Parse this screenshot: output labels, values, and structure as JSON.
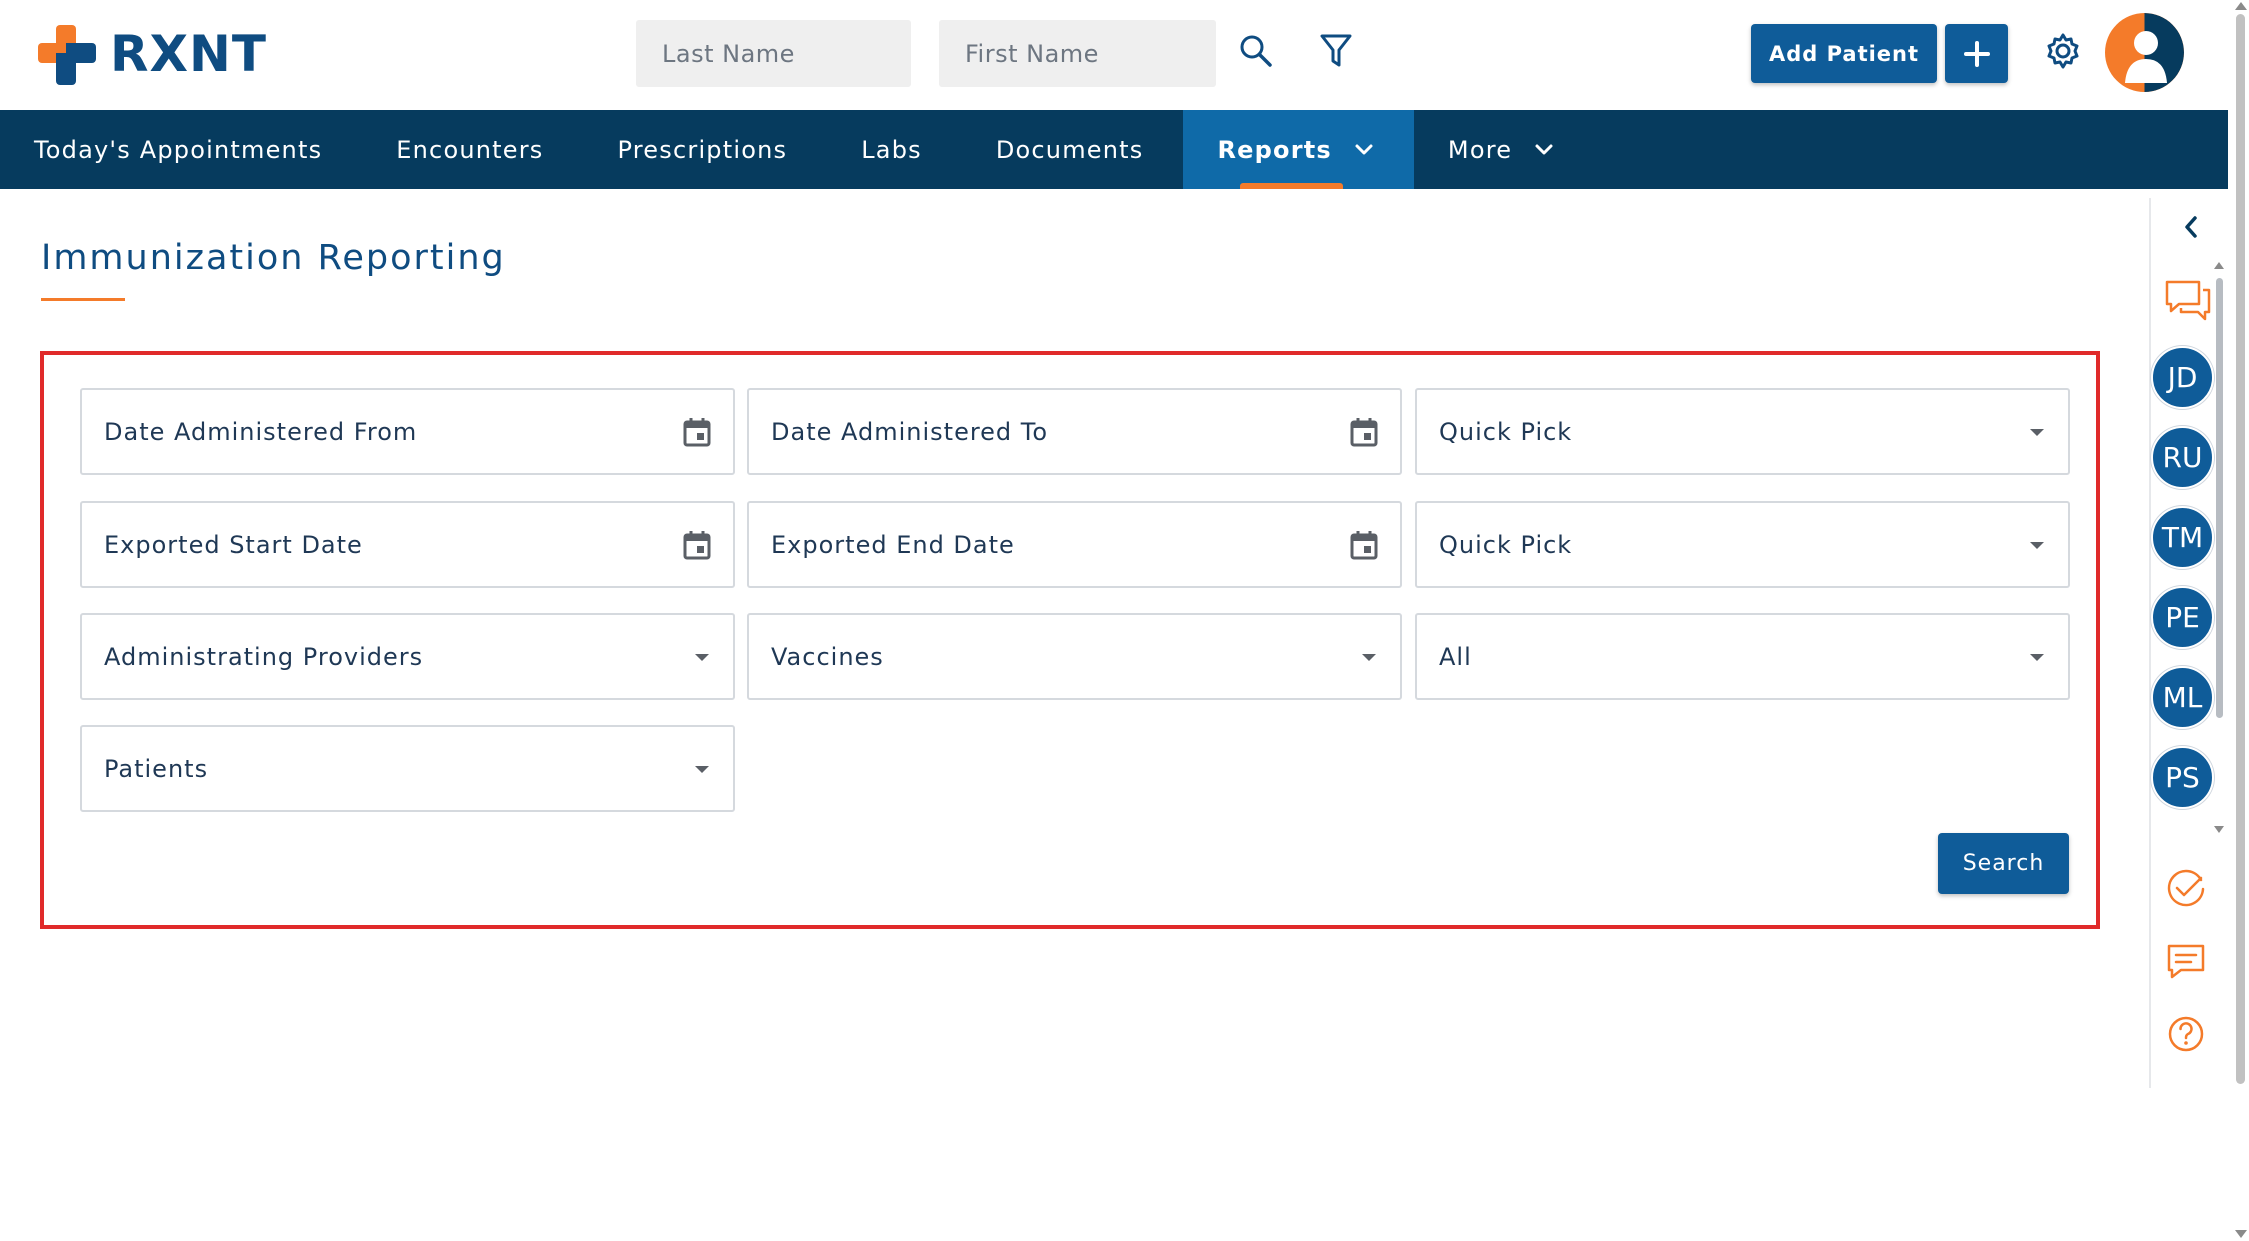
{
  "app": {
    "brand": "RXNT",
    "colors": {
      "primary": "#0f5c99",
      "nav": "#063b5e",
      "accent": "#f47b2a",
      "highlight_border": "#e02a2a"
    }
  },
  "header": {
    "last_name_placeholder": "Last Name",
    "first_name_placeholder": "First Name",
    "search_icon": "search-icon",
    "filter_icon": "filter-icon",
    "add_patient_label": "Add Patient",
    "plus_icon": "plus-icon",
    "settings_icon": "gear-icon",
    "user_icon": "user-avatar-icon"
  },
  "nav": {
    "items": [
      {
        "label": "Today's Appointments",
        "active": false
      },
      {
        "label": "Encounters",
        "active": false
      },
      {
        "label": "Prescriptions",
        "active": false
      },
      {
        "label": "Labs",
        "active": false
      },
      {
        "label": "Documents",
        "active": false
      },
      {
        "label": "Reports",
        "active": true,
        "dropdown": true
      },
      {
        "label": "More",
        "active": false,
        "dropdown": true
      }
    ]
  },
  "page": {
    "title": "Immunization Reporting"
  },
  "form": {
    "date_administered_from": "Date Administered From",
    "date_administered_to": "Date Administered To",
    "quick_pick_1": "Quick Pick",
    "exported_start_date": "Exported Start Date",
    "exported_end_date": "Exported End Date",
    "quick_pick_2": "Quick Pick",
    "administrating_providers": "Administrating Providers",
    "vaccines": "Vaccines",
    "status_filter": "All",
    "patients": "Patients",
    "search_label": "Search"
  },
  "sidebar": {
    "collapse_icon": "chevron-left-icon",
    "chat_icon": "chat-bubbles-icon",
    "users": [
      {
        "initials": "JD"
      },
      {
        "initials": "RU"
      },
      {
        "initials": "TM"
      },
      {
        "initials": "PE"
      },
      {
        "initials": "ML"
      },
      {
        "initials": "PS"
      }
    ],
    "tasks_icon": "check-circle-icon",
    "messages_icon": "message-icon",
    "help_icon": "help-circle-icon"
  }
}
